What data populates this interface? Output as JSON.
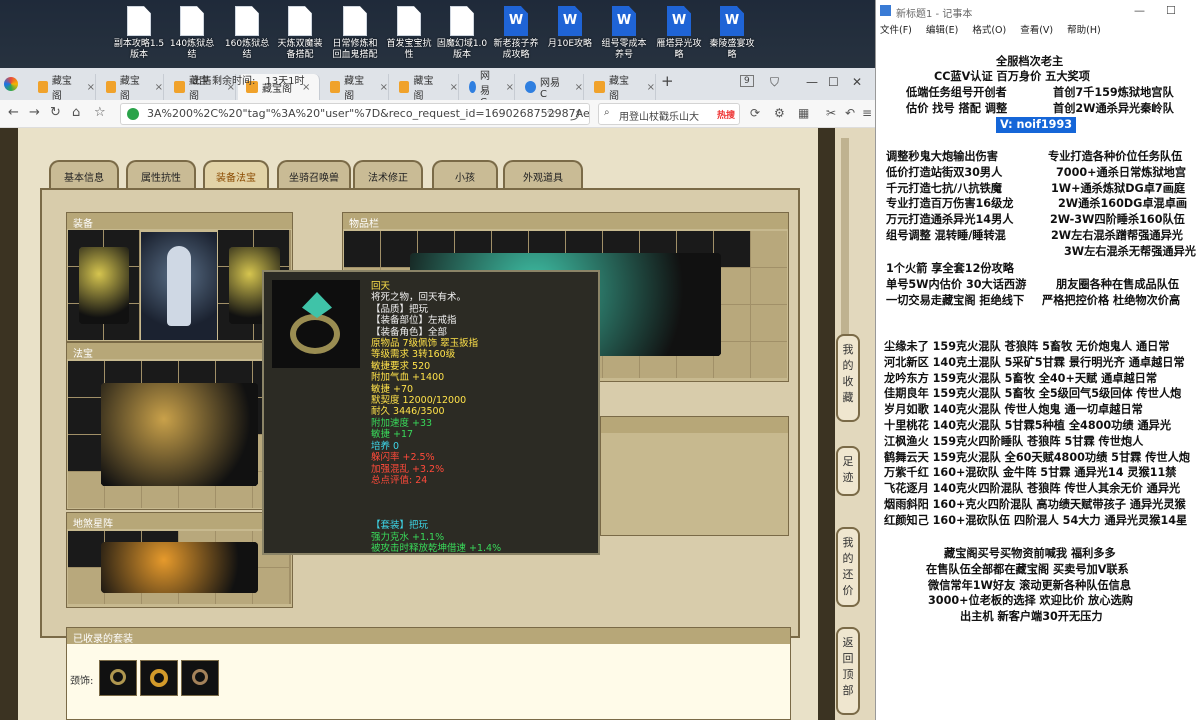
{
  "desktop": {
    "icons": [
      {
        "label": "副本攻略1.5\n版本",
        "type": "file"
      },
      {
        "label": "140炼狱总结",
        "type": "file"
      },
      {
        "label": "160炼狱总结",
        "type": "file"
      },
      {
        "label": "天炼双魔装\n备搭配",
        "type": "file"
      },
      {
        "label": "日常修炼和\n回血鬼搭配",
        "type": "file"
      },
      {
        "label": "首发宝宝抗\n性",
        "type": "file"
      },
      {
        "label": "固魔幻域1.0\n版本",
        "type": "file"
      },
      {
        "label": "新老孩子养\n成攻略",
        "type": "doc"
      },
      {
        "label": "月10E攻略",
        "type": "doc"
      },
      {
        "label": "组号零成本\n养号",
        "type": "doc"
      },
      {
        "label": "雁塔异光攻\n略",
        "type": "doc"
      },
      {
        "label": "秦陵盛宴攻\n略",
        "type": "doc"
      }
    ]
  },
  "browser": {
    "tabs": [
      {
        "label": "藏宝阁"
      },
      {
        "label": "藏宝阁"
      },
      {
        "label": "藏宝阁"
      },
      {
        "label": "藏宝阁"
      },
      {
        "label": "藏宝阁"
      },
      {
        "label": "藏宝阁"
      },
      {
        "label": "网易C"
      },
      {
        "label": "网易C"
      },
      {
        "label": "藏宝阁"
      }
    ],
    "tab_count": "9",
    "url": "3A%200%2C%20\"tag\"%3A%20\"user\"%7D&reco_request_id=1690268752987AeLgv",
    "search_text": "用登山杖戳乐山大",
    "search_hot": "热搜"
  },
  "page": {
    "remain_label": "出售剩余时间:",
    "remain_value": "13天1时",
    "game_tabs": [
      "基本信息",
      "属性抗性",
      "装备法宝",
      "坐骑召唤兽",
      "法术修正",
      "小孩",
      "外观道具"
    ],
    "equip_title": "装备",
    "inventory_title": "物品栏",
    "treasure_title": "法宝",
    "beast_title": "地煞星阵",
    "set_title": "已收录的套装",
    "set_label": "颈饰:",
    "side_buttons": [
      "我的收藏",
      "足迹",
      "我的还价",
      "返回顶部"
    ]
  },
  "tooltip": {
    "name": "回天",
    "lines": [
      {
        "text": "将死之物，回天有术。",
        "color": "white"
      },
      {
        "text": "【品质】把玩",
        "color": "white"
      },
      {
        "text": "【装备部位】左戒指",
        "color": "white"
      },
      {
        "text": "【装备角色】全部",
        "color": "white"
      },
      {
        "text": "原物品 7级佩饰 翠玉扳指",
        "color": "yellow"
      },
      {
        "text": "等级需求 3转160级",
        "color": "yellow"
      },
      {
        "text": "敏捷要求 520",
        "color": "yellow"
      },
      {
        "text": "附加气血 +1400",
        "color": "yellow"
      },
      {
        "text": "敏捷 +70",
        "color": "yellow"
      },
      {
        "text": "默契度 12000/12000",
        "color": "yellow"
      },
      {
        "text": "耐久 3446/3500",
        "color": "yellow"
      },
      {
        "text": "附加速度 +33",
        "color": "green"
      },
      {
        "text": "敏捷 +17",
        "color": "green"
      },
      {
        "text": "培养 0",
        "color": "cyan"
      },
      {
        "text": "躲闪率 +2.5%",
        "color": "red"
      },
      {
        "text": "加强混乱 +3.2%",
        "color": "red"
      },
      {
        "text": "总点评值: 24",
        "color": "red"
      }
    ],
    "set_lines": [
      {
        "text": "【套装】把玩",
        "color": "cyan"
      },
      {
        "text": "强力克水 +1.1%",
        "color": "green"
      },
      {
        "text": "被攻击时释放乾坤借速 +1.4%",
        "color": "green"
      }
    ]
  },
  "notepad": {
    "title": "新标题1 - 记事本",
    "menu": [
      "文件(F)",
      "编辑(E)",
      "格式(O)",
      "查看(V)",
      "帮助(H)"
    ],
    "header": [
      "全服档次老主",
      "CC蓝V认证 百万身价 五大奖项",
      "低端任务组号开创者",
      "首创7千159炼狱地宫队",
      "估价 找号 搭配 调整",
      "首创2W通杀异光秦岭队",
      "V: noif1993"
    ],
    "block1_left": [
      "调整秒鬼大炮输出伤害",
      "低价打造站街双30男人",
      "千元打造七抗/八抗铁魔",
      "专业打造百万伤害16级龙",
      "万元打造通杀异光14男人",
      "组号调整 混转睡/睡转混"
    ],
    "block1_right": [
      "专业打造各种价位任务队伍",
      "7000+通杀日常炼狱地宫",
      "1W+通杀炼狱DG卓7画庭",
      "2W通杀160DG卓混卓画",
      "2W-3W四阶睡杀160队伍",
      "2W左右混杀蹭帮强通异光",
      "3W左右混杀无帮强通异光"
    ],
    "block2": [
      "1个火箭 享全套12份攻略",
      "单号5W内估价 30大话西游",
      "朋友圈各种在售成品队伍",
      "一切交易走藏宝阁 拒绝线下",
      "严格把控价格 杜绝物次价高"
    ],
    "teams": [
      "尘缘未了 159克火混队 苍狼阵 5畜牧 无价炮鬼人 通日常",
      "河北新区 140克土混队 5采矿5甘霖 景行明光齐 通卓越日常",
      "龙吟东方 159克火混队 5畜牧 全40+天赋 通卓越日常",
      "佳期良年 159克火混队 5畜牧 全5级回气5级回体 传世人炮",
      "岁月如歌 140克火混队 传世人炮鬼 通一切卓越日常",
      "十里桃花 140克火混队 5甘霖5种植 全4800功绩 通异光",
      "江枫渔火 159克火四阶睡队 苍狼阵 5甘霖 传世炮人",
      "鹤舞云天 159克火混队 全60天赋4800功绩 5甘霖 传世人炮",
      "万紫千红 160+混砍队 金牛阵 5甘霖 通异光14 灵猴11禁",
      "飞花逐月 140克火四阶混队 苍狼阵 传世人其余无价 通异光",
      "烟雨斜阳 160+克火四阶混队 高功绩天赋带孩子 通异光灵猴",
      "红颜知己 160+混砍队伍 四阶混人 54大力 通异光灵猴14星"
    ],
    "footer": [
      "藏宝阁买号买物资前喊我 福利多多",
      "在售队伍全部都在藏宝阁 买卖号加V联系",
      "微信常年1W好友 滚动更新各种队伍信息",
      "3000+位老板的选择 欢迎比价 放心选购",
      "出主机 新客户端30开无压力"
    ]
  }
}
